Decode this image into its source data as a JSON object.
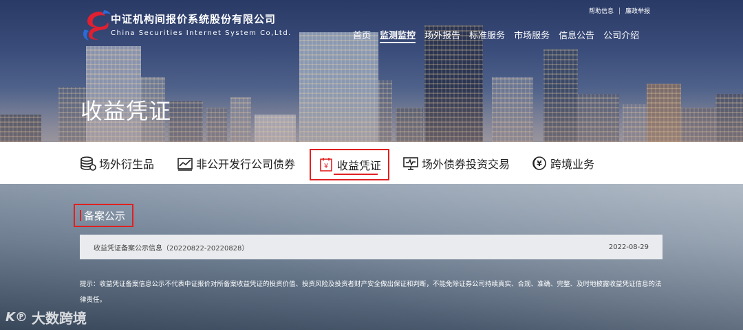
{
  "header": {
    "company_cn": "中证机构间报价系统股份有限公司",
    "company_en": "China Securities Internet System Co,Ltd.",
    "top_links": [
      "帮助信息",
      "廉政举报"
    ],
    "nav": [
      "首页",
      "监测监控",
      "场外报告",
      "标准服务",
      "市场服务",
      "信息公告",
      "公司介绍"
    ],
    "nav_active": "监测监控",
    "hero_title": "收益凭证"
  },
  "tabs": [
    {
      "label": "场外衍生品",
      "icon": "coins-stack-icon"
    },
    {
      "label": "非公开发行公司债券",
      "icon": "chart-trend-icon"
    },
    {
      "label": "收益凭证",
      "icon": "yen-document-icon",
      "active": true
    },
    {
      "label": "场外债券投资交易",
      "icon": "monitor-pulse-icon"
    },
    {
      "label": "跨境业务",
      "icon": "yen-circle-icon"
    }
  ],
  "section": {
    "title": "备案公示"
  },
  "notices": [
    {
      "title": "收益凭证备案公示信息（20220822-20220828）",
      "date": "2022-08-29"
    }
  ],
  "tip": "提示：收益凭证备案信息公示不代表中证报价对所备案收益凭证的投资价值、投资风险及投资者财产安全做出保证和判断，不能免除证券公司持续真实、合规、准确、完整、及时地披露收益凭证信息的法律责任。",
  "watermark": "大数跨境",
  "colors": {
    "accent": "#e02020",
    "hero": "#3a4c7a",
    "row_bg": "#e9ebee"
  }
}
